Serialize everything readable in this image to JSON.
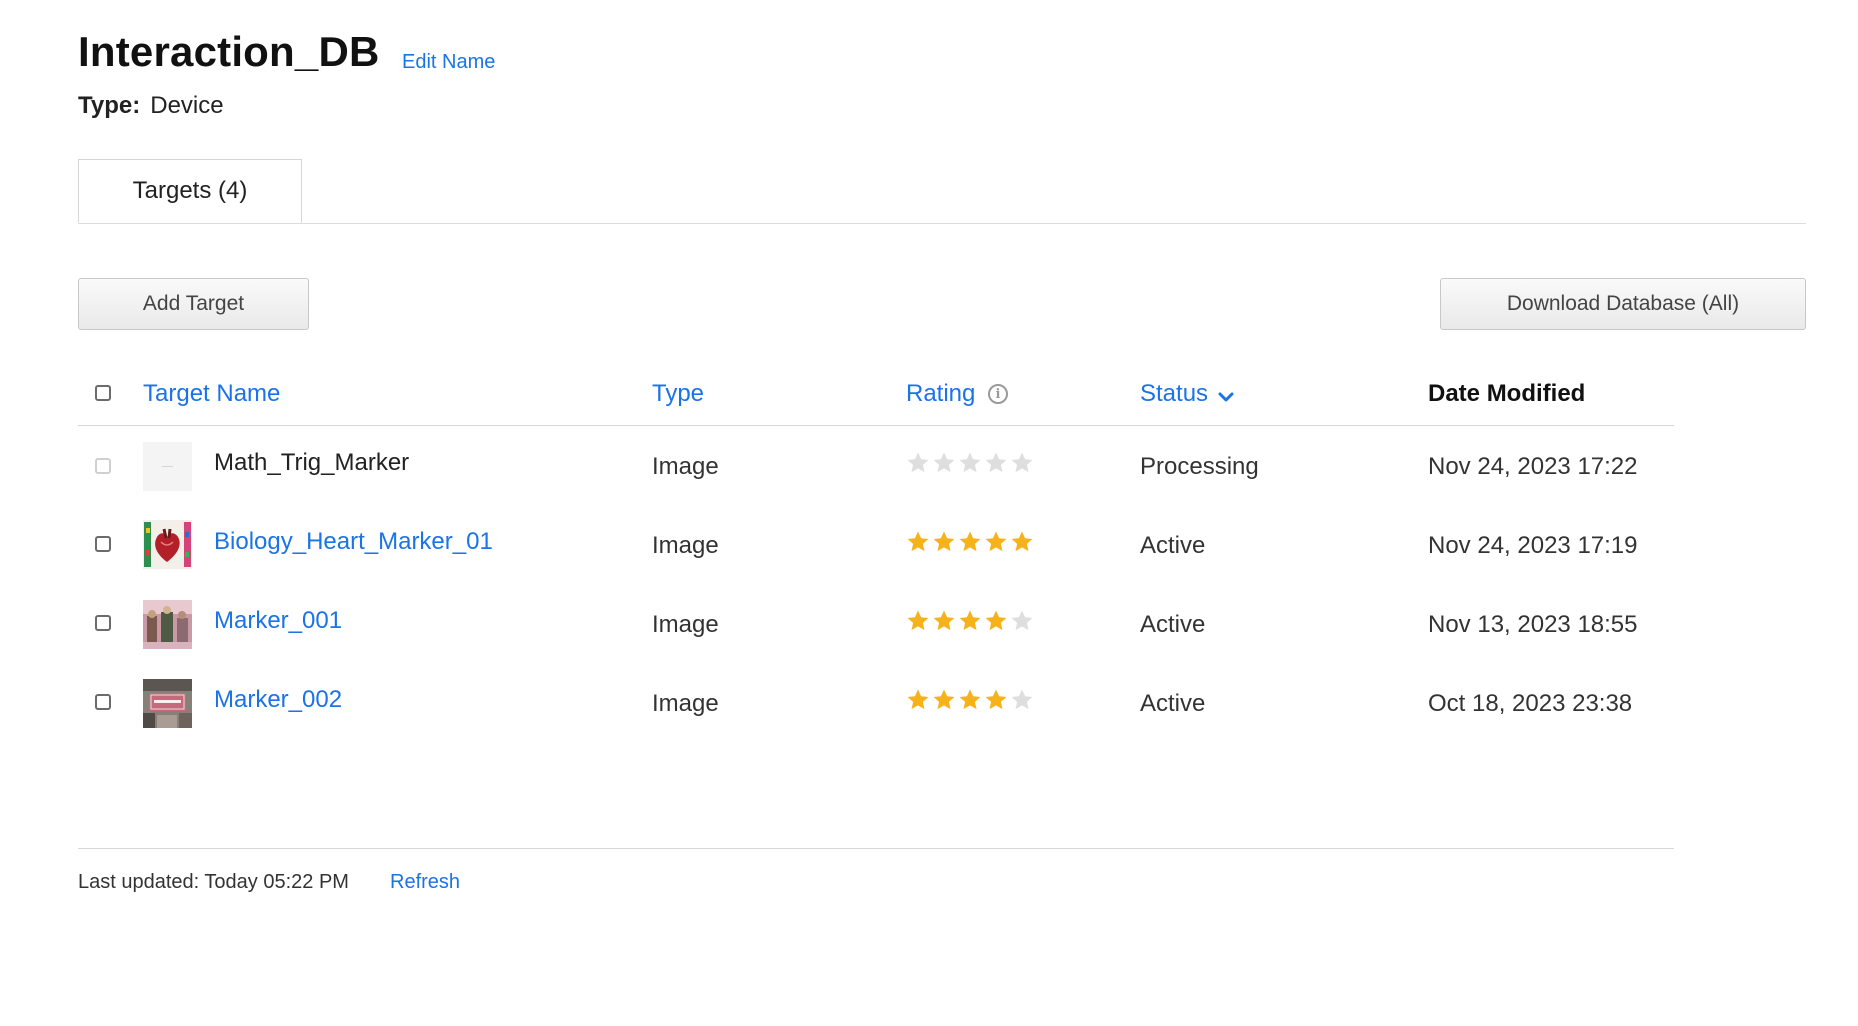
{
  "header": {
    "title": "Interaction_DB",
    "edit_label": "Edit Name",
    "type_label": "Type:",
    "type_value": "Device"
  },
  "tabs": [
    {
      "label": "Targets (4)",
      "active": true
    }
  ],
  "toolbar": {
    "add_label": "Add Target",
    "download_label": "Download Database (All)"
  },
  "table": {
    "columns": {
      "name": "Target Name",
      "type": "Type",
      "rating": "Rating",
      "status": "Status",
      "date": "Date Modified"
    },
    "rows": [
      {
        "name": "Math_Trig_Marker",
        "type": "Image",
        "rating": 0,
        "status": "Processing",
        "date": "Nov 24, 2023 17:22",
        "link": false,
        "thumb": "placeholder-thumbnail"
      },
      {
        "name": "Biology_Heart_Marker_01",
        "type": "Image",
        "rating": 5,
        "status": "Active",
        "date": "Nov 24, 2023 17:19",
        "link": true,
        "thumb": "heart-thumbnail"
      },
      {
        "name": "Marker_001",
        "type": "Image",
        "rating": 4,
        "status": "Active",
        "date": "Nov 13, 2023 18:55",
        "link": true,
        "thumb": "photo-thumbnail"
      },
      {
        "name": "Marker_002",
        "type": "Image",
        "rating": 4,
        "status": "Active",
        "date": "Oct 18, 2023 23:38",
        "link": true,
        "thumb": "welcome-thumbnail"
      }
    ]
  },
  "footer": {
    "last_updated": "Last updated: Today 05:22 PM",
    "refresh_label": "Refresh"
  },
  "colors": {
    "link": "#1a73e8",
    "star_on": "#f5b21b",
    "star_off": "#dedede"
  },
  "icons": {
    "rating_info": "info-icon",
    "status_sort": "chevron-down-icon",
    "star": "star-icon"
  }
}
